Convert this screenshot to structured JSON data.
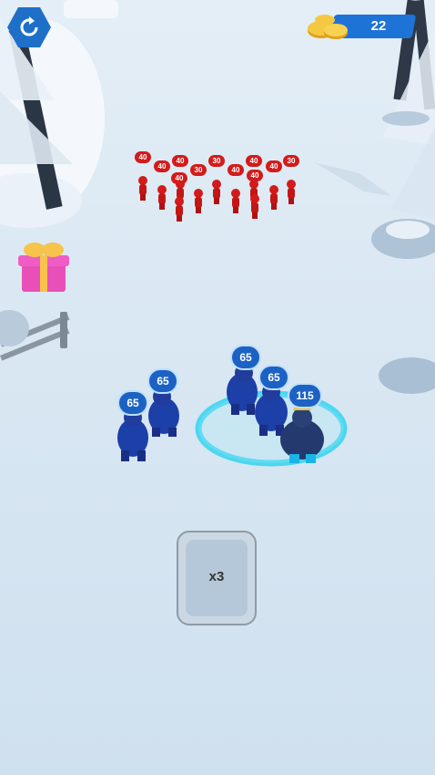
{
  "hud": {
    "coins": "22",
    "restart_icon": "restart-icon",
    "coin_icon": "gold-coins-icon"
  },
  "enemy_squad": {
    "color": "#d31b1b",
    "labels": [
      "40",
      "40",
      "40",
      "30",
      "30",
      "40",
      "40",
      "40",
      "30",
      "40",
      "40"
    ]
  },
  "player_squad": {
    "color": "#1c3fa8",
    "labels": [
      "65",
      "65",
      "65",
      "65",
      "115"
    ],
    "leader_label": "115"
  },
  "gift": {
    "icon": "gift-box-icon"
  },
  "boost_card": {
    "label": "x3"
  }
}
